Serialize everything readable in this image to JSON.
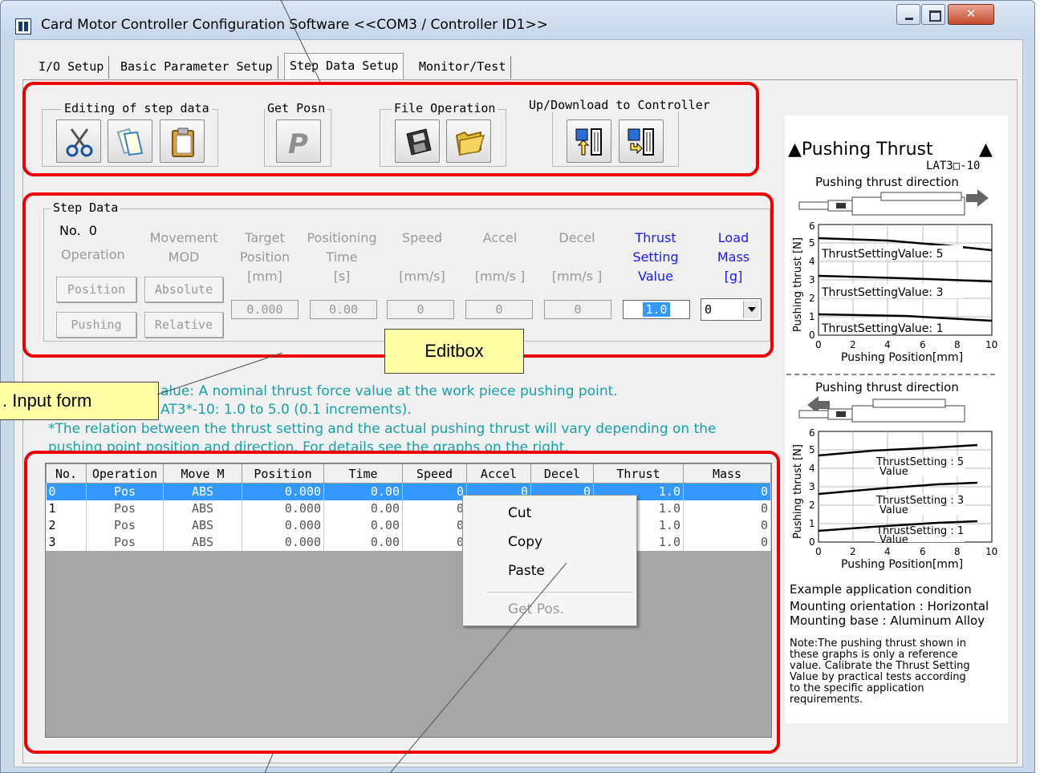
{
  "window": {
    "title": "Card Motor Controller Configuration Software <<COM3 / Controller ID1>>"
  },
  "tabs": [
    {
      "label": "I/O Setup"
    },
    {
      "label": "Basic Parameter Setup"
    },
    {
      "label": "Step Data Setup",
      "active": true
    },
    {
      "label": "Monitor/Test"
    }
  ],
  "toolbar": {
    "editing_label": "Editing of step data",
    "getposn_label": "Get Posn",
    "file_label": "File Operation",
    "updown_label": "Up/Download to Controller",
    "buttons": [
      {
        "icon": "scissors-icon",
        "action": "cut"
      },
      {
        "icon": "copy-pages-icon",
        "action": "copy"
      },
      {
        "icon": "clipboard-icon",
        "action": "paste"
      },
      {
        "icon": "p-position-icon",
        "action": "get-position"
      },
      {
        "icon": "save-disk-icon",
        "action": "save"
      },
      {
        "icon": "open-folder-icon",
        "action": "open"
      },
      {
        "icon": "upload-controller-icon",
        "action": "upload"
      },
      {
        "icon": "download-controller-icon",
        "action": "download"
      }
    ]
  },
  "step_data": {
    "group_label": "Step Data",
    "no_label": "No.",
    "no_value": "0",
    "headers": {
      "operation": "Operation",
      "movement_1": "Movement",
      "movement_2": "MOD",
      "target_1": "Target",
      "target_2": "Position",
      "target_3": "[mm]",
      "positioning_1": "Positioning",
      "positioning_2": "Time",
      "positioning_3": "[s]",
      "speed_1": "Speed",
      "speed_2": "[mm/s]",
      "accel_1": "Accel",
      "accel_2": "[mm/s ]",
      "decel_1": "Decel",
      "decel_2": "[mm/s ]",
      "thrust_1": "Thrust",
      "thrust_2": "Setting",
      "thrust_3": "Value",
      "load_1": "Load",
      "load_2": "Mass",
      "load_3": "[g]"
    },
    "buttons": {
      "position": "Position",
      "pushing": "Pushing",
      "absolute": "Absolute",
      "relative": "Relative"
    },
    "fields": {
      "target": "0.000",
      "time": "0.00",
      "speed": "0",
      "accel": "0",
      "decel": "0",
      "thrust": "1.0",
      "load": "0"
    }
  },
  "description": {
    "line1": "alue: A nominal thrust force value at the work piece pushing point.",
    "line2": "AT3*-10: 1.0 to 5.0 (0.1 increments).",
    "line3": "*The relation between the thrust setting and the actual pushing thrust will vary depending on the",
    "line4": "pushing point position and direction. For details see the graphs on the right."
  },
  "table": {
    "headers": [
      "No.",
      "Operation",
      "Move M",
      "Position",
      "Time",
      "Speed",
      "Accel",
      "Decel",
      "Thrust",
      "Mass"
    ],
    "rows": [
      [
        "0",
        "Pos",
        "ABS",
        "0.000",
        "0.00",
        "0",
        "0",
        "0",
        "1.0",
        "0"
      ],
      [
        "1",
        "Pos",
        "ABS",
        "0.000",
        "0.00",
        "0",
        "",
        "",
        "1.0",
        "0"
      ],
      [
        "2",
        "Pos",
        "ABS",
        "0.000",
        "0.00",
        "0",
        "",
        "",
        "1.0",
        "0"
      ],
      [
        "3",
        "Pos",
        "ABS",
        "0.000",
        "0.00",
        "0",
        "",
        "",
        "1.0",
        "0"
      ]
    ]
  },
  "context_menu": {
    "items": [
      {
        "label": "Cut",
        "enabled": true
      },
      {
        "label": "Copy",
        "enabled": true
      },
      {
        "label": "Paste",
        "enabled": true
      },
      {
        "label": "Get Pos.",
        "enabled": false
      }
    ]
  },
  "right_panel": {
    "title": "▲Pushing Thrust",
    "model": "LAT3□-10",
    "direction_label": "Pushing thrust direction",
    "chart1": {
      "ylabel": "Pushing thrust [N]",
      "xlabel": "Pushing Position[mm]",
      "curve_labels": [
        "ThrustSettingValue: 5",
        "ThrustSettingValue: 3",
        "ThrustSettingValue: 1"
      ]
    },
    "chart2": {
      "ylabel": "Pushing thrust [N]",
      "xlabel": "Pushing Position[mm]",
      "curve_labels": [
        "ThrustSetting : 5",
        "ThrustSetting : 3",
        "ThrustSetting : 1"
      ],
      "value_label": "Value"
    },
    "x_ticks": [
      "0",
      "2",
      "4",
      "6",
      "8",
      "10"
    ],
    "y_ticks": [
      "0",
      "1",
      "2",
      "3",
      "4",
      "5",
      "6"
    ],
    "example_title": "Example application condition",
    "mounting_orientation": "Mounting orientation : Horizontal",
    "mounting_base": "Mounting base : Aluminum Alloy",
    "note": [
      "Note:The pushing thrust shown in",
      "these graphs is only a reference",
      "value. Calibrate the Thrust Setting",
      "Value by practical tests according",
      "to the specific application",
      "requirements."
    ]
  },
  "annotations": {
    "editbox": "Editbox",
    "input_form": ". Input form"
  }
}
